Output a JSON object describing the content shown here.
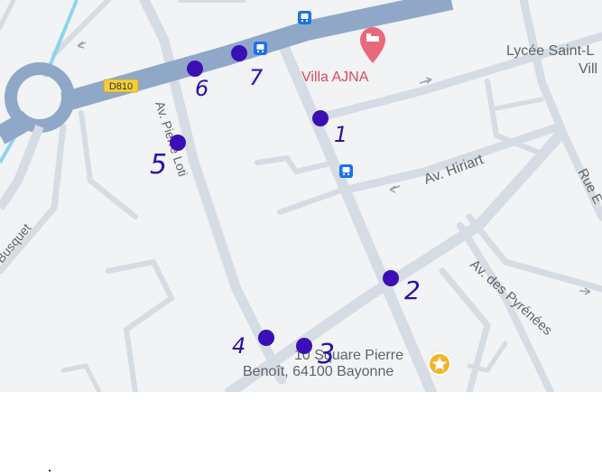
{
  "map": {
    "street_labels": {
      "av_pierre_loti": "Av. Pierre Loti",
      "av_hiriart": "Av. Hiriart",
      "av_des_pyrenees": "Av. des Pyrénées",
      "rue_e": "Rue E",
      "busquet": "Busquet",
      "road_badge": "D810"
    },
    "places": {
      "villa": "Villa AJNA",
      "lycee_line1": "Lycée Saint-L",
      "lycee_line2": "Vill"
    },
    "address": {
      "line1": "10 Square Pierre",
      "line2": "Benoît, 64100 Bayonne"
    },
    "annotations": {
      "n1": "1",
      "n2": "2",
      "n3": "3",
      "n4": "4",
      "n5": "5",
      "n6": "6",
      "n7": "7"
    },
    "colors": {
      "background": "#f1f3f4",
      "road": "#d5dce3",
      "main_road": "#8fa8c8",
      "water": "#8fd3f0",
      "marker_dot": "#3b0fb5",
      "pin": "#e8697a",
      "star": "#f3b32a",
      "bus": "#1a73e8"
    },
    "icons": [
      "bus-stop-icon",
      "hotel-pin-icon",
      "star-icon"
    ]
  }
}
